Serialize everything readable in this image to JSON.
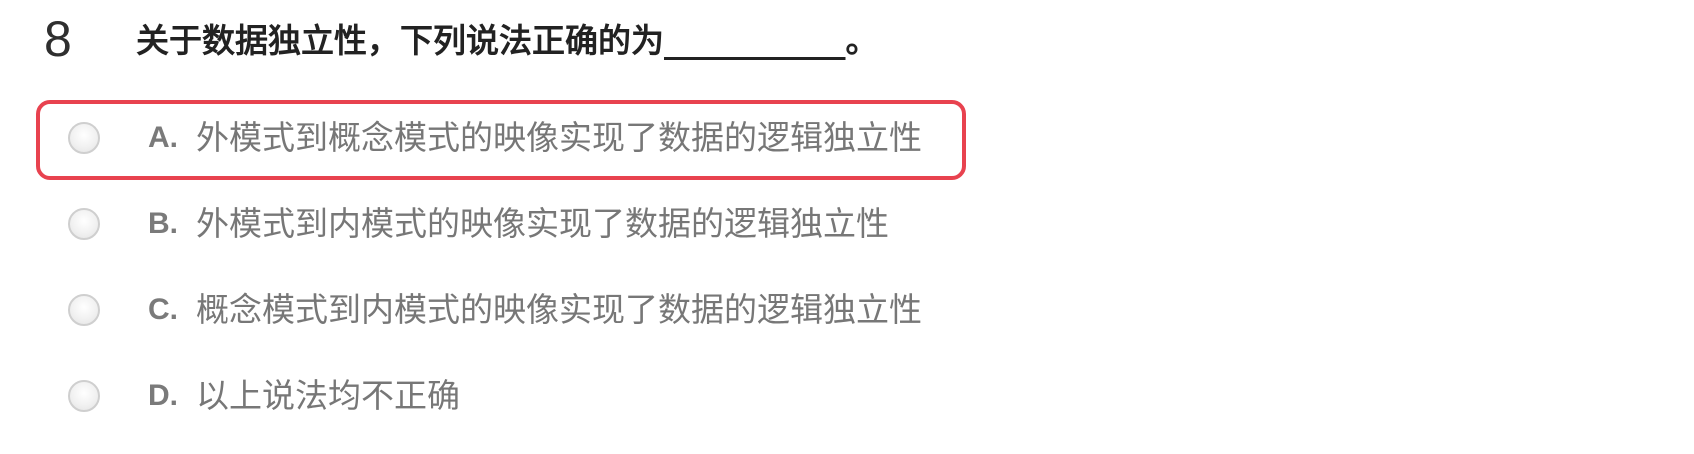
{
  "question": {
    "number": "8",
    "text": "关于数据独立性，下列说法正确的为___________。"
  },
  "options": [
    {
      "letter": "A.",
      "text": "外模式到概念模式的映像实现了数据的逻辑独立性",
      "highlighted": true
    },
    {
      "letter": "B.",
      "text": "外模式到内模式的映像实现了数据的逻辑独立性",
      "highlighted": false
    },
    {
      "letter": "C.",
      "text": "概念模式到内模式的映像实现了数据的逻辑独立性",
      "highlighted": false
    },
    {
      "letter": "D.",
      "text": "以上说法均不正确",
      "highlighted": false
    }
  ],
  "colors": {
    "highlight_border": "#e8424f",
    "question_text": "#222222",
    "option_text": "#777777"
  }
}
